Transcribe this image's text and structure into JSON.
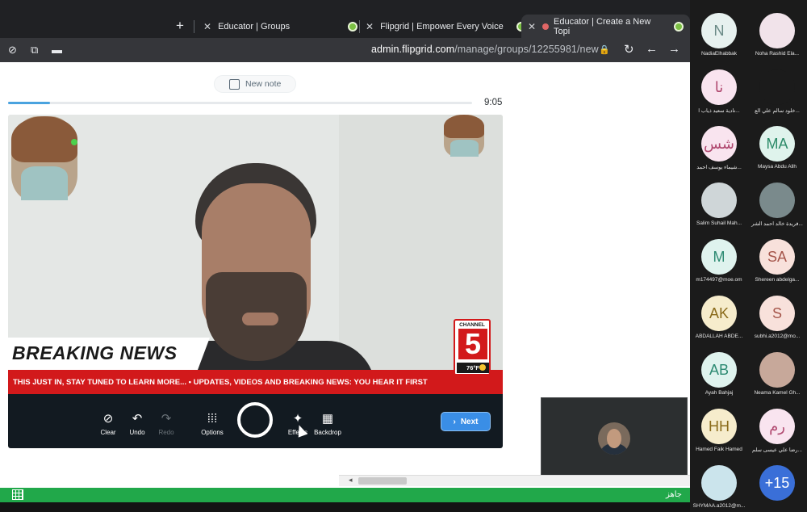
{
  "browser": {
    "new_tab_glyph": "+",
    "tabs": [
      {
        "title": "Educator | Groups",
        "close": "✕"
      },
      {
        "title": "Flipgrid | Empower Every Voice",
        "close": "✕"
      },
      {
        "title": "Educator | Create a New Topi",
        "close": "✕"
      }
    ],
    "url_host": "admin.flipgrid.com",
    "url_path": "/manage/groups/12255981/new"
  },
  "recorder": {
    "new_note_label": "New note",
    "timer": "9:05",
    "progress_fraction": 0.09,
    "overlay_headline": "BREAKING NEWS",
    "ticker_text": "THIS JUST IN, STAY TUNED TO LEARN MORE...  •  UPDATES, VIDEOS AND BREAKING NEWS: YOU HEAR IT FIRST",
    "channel_label": "CHANNEL",
    "channel_number": "5",
    "channel_temp": "76°F",
    "controls": {
      "clear": "Clear",
      "undo": "Undo",
      "redo": "Redo",
      "options": "Options",
      "effects": "Effects",
      "backdrop": "Backdrop",
      "next": "Next"
    }
  },
  "statusbar": {
    "text": "جاهز"
  },
  "participants": [
    {
      "initials": "N",
      "name": "NadiaElhabbak",
      "bg": "#e7f1ef",
      "fg": "#6a8a86"
    },
    {
      "initials": "",
      "name": "Noha Rashid Ela...",
      "bg": "#f1e3ea",
      "fg": "#7a5a6a"
    },
    {
      "initials": "نا",
      "name": "نادية سعيد ذياب ا...",
      "bg": "#f9e4ef",
      "fg": "#b0486f"
    },
    {
      "initials": "",
      "name": "خلود سالم علي الع...",
      "bg": "#1b1b1b",
      "fg": "#e6e6e6"
    },
    {
      "initials": "شس",
      "name": "شيماء يوسف احمد...",
      "bg": "#f9e4ef",
      "fg": "#b0486f"
    },
    {
      "initials": "MA",
      "name": "Maysa Abdu Allh",
      "bg": "#dff3ec",
      "fg": "#2c8a68"
    },
    {
      "initials": "",
      "name": "Salim Suhail Mah...",
      "bg": "#cfd6d8",
      "fg": "#3a3a3a"
    },
    {
      "initials": "",
      "name": "فريدة خالد احمد الشر...",
      "bg": "#7a8a8c",
      "fg": "#ffffff"
    },
    {
      "initials": "M",
      "name": "m174497@moe.om",
      "bg": "#dff3ee",
      "fg": "#2c8a72"
    },
    {
      "initials": "SA",
      "name": "Shereen abdelga...",
      "bg": "#f8e1db",
      "fg": "#a5554a"
    },
    {
      "initials": "AK",
      "name": "ABDALLAH ABDE...",
      "bg": "#f6eccc",
      "fg": "#8a6a1a"
    },
    {
      "initials": "S",
      "name": "subhi.a2012@mo...",
      "bg": "#f8e1db",
      "fg": "#a5554a"
    },
    {
      "initials": "AB",
      "name": "Ayah Bahjaj",
      "bg": "#dff3ee",
      "fg": "#2c8a72"
    },
    {
      "initials": "",
      "name": "Neama Kamel Gh...",
      "bg": "#c7a89a",
      "fg": "#ffffff"
    },
    {
      "initials": "HH",
      "name": "Hamed Faik Hamed",
      "bg": "#f6eccc",
      "fg": "#8a6a1a"
    },
    {
      "initials": "رم",
      "name": "رضا علي عيسى سلم...",
      "bg": "#f9e4ef",
      "fg": "#b0486f"
    },
    {
      "initials": "",
      "name": "SHYMAA.a2012@m...",
      "bg": "#cbe4ec",
      "fg": "#3a3a3a"
    },
    {
      "initials": "+15",
      "name": "",
      "bg": "#3a6fd8",
      "fg": "#ffffff"
    }
  ],
  "colors": {
    "accent": "#3a8ee6",
    "ticker": "#d2191b",
    "status_green": "#21a84a"
  }
}
